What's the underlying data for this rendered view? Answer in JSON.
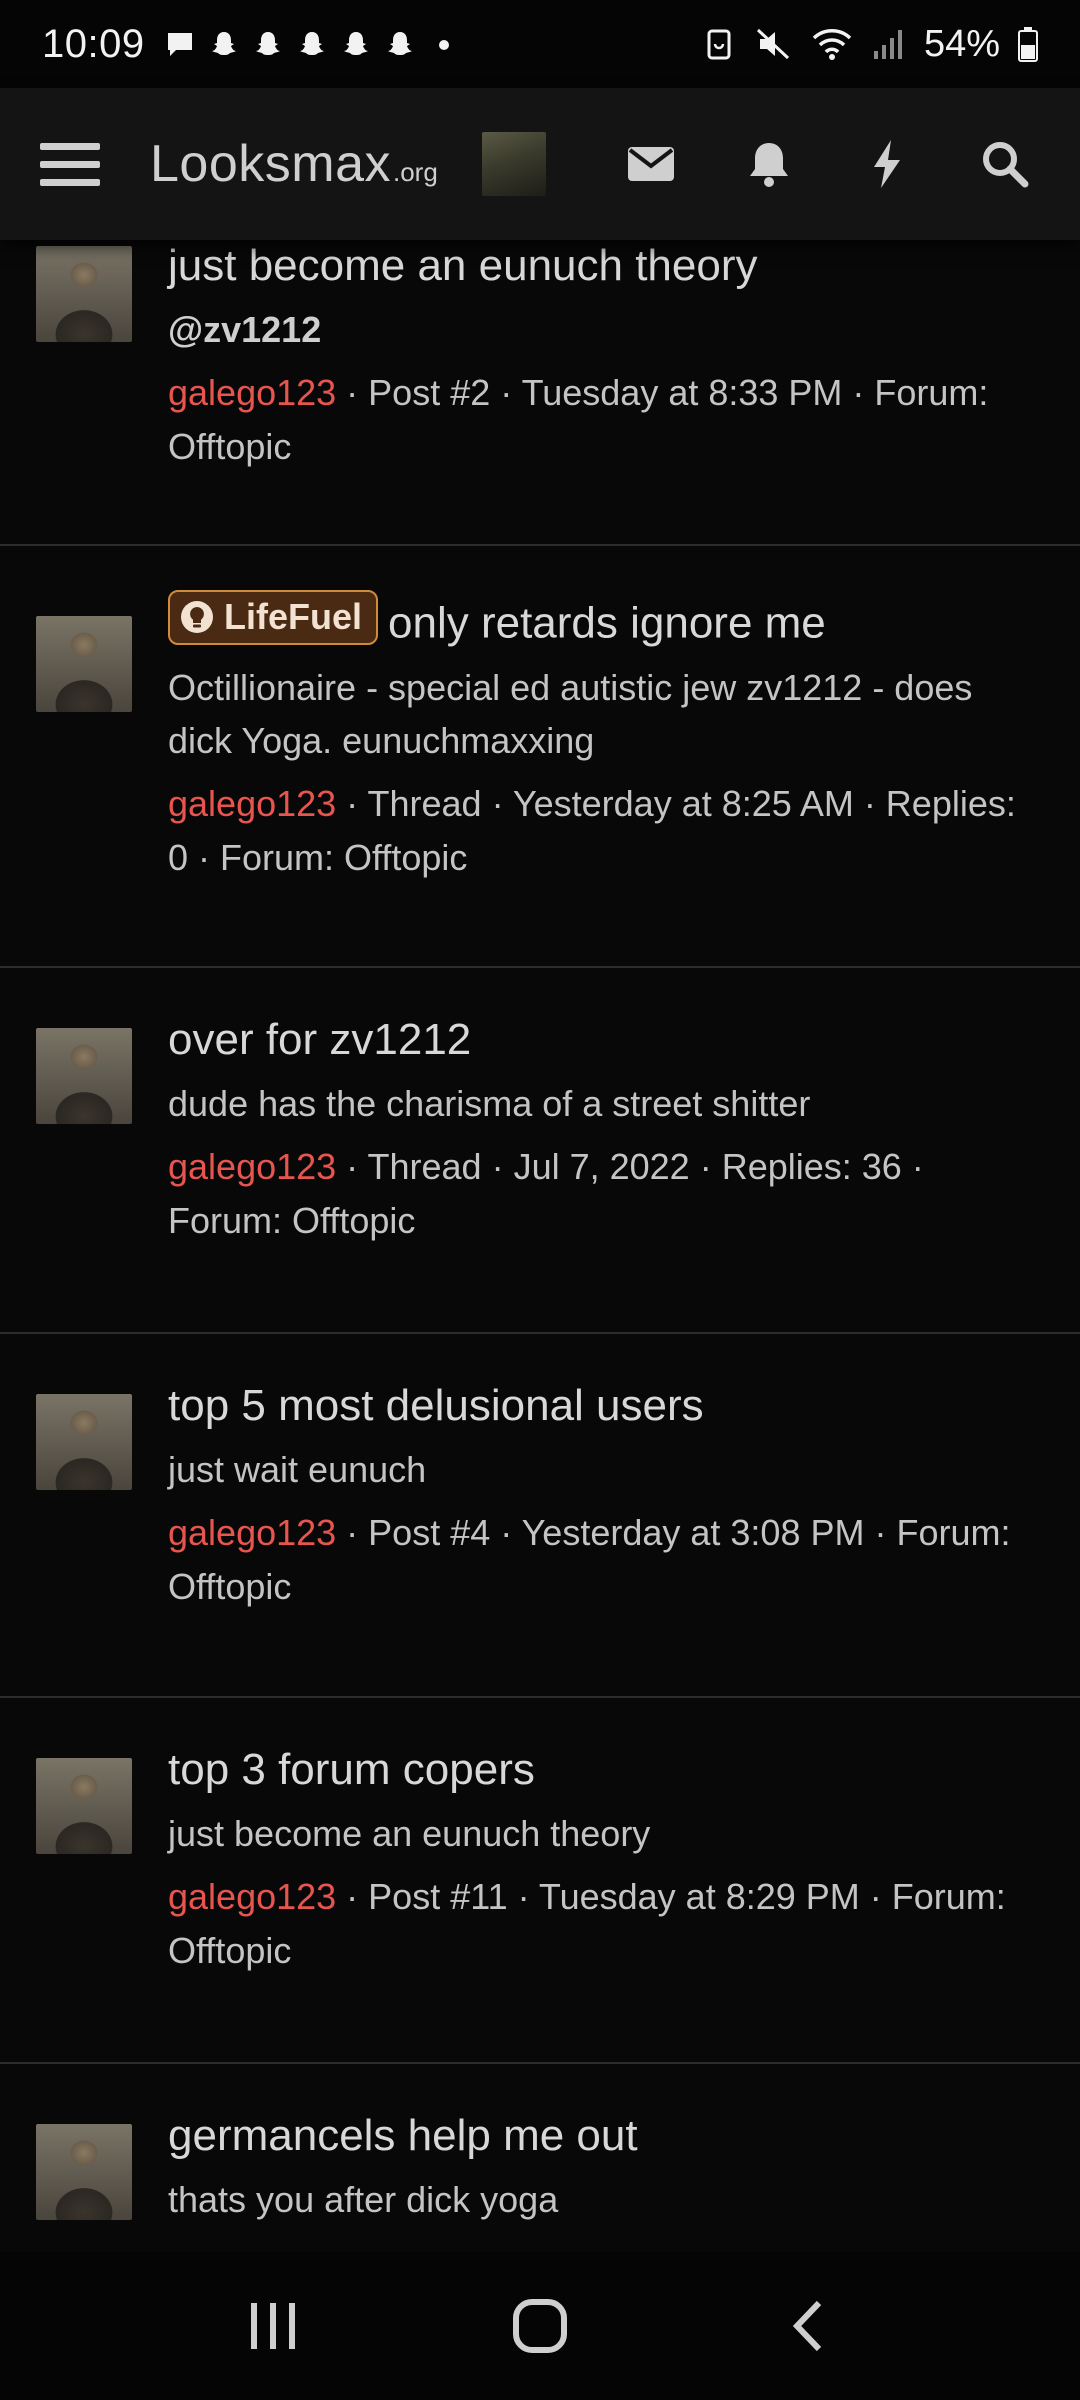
{
  "status_bar": {
    "time": "10:09",
    "battery": "54%",
    "notification_icons": [
      "chat-bubble-icon",
      "snapchat-icon",
      "snapchat-icon",
      "snapchat-icon",
      "snapchat-icon",
      "snapchat-icon",
      "dot-icon"
    ]
  },
  "header": {
    "logo_main": "Looksmax",
    "logo_suffix": ".org",
    "icons": [
      "mail-icon",
      "bell-icon",
      "bolt-icon",
      "search-icon"
    ]
  },
  "colors": {
    "username": "#e8554e",
    "prefix_bg": "#4a2a12",
    "prefix_border": "#d08a3a",
    "background": "#080808"
  },
  "results": [
    {
      "title": "just become an eunuch theory",
      "prefix": "",
      "snippet": "@zv1212",
      "snippet_bold": true,
      "user": "galego123",
      "meta": " · Post #2 · Tuesday at 8:33 PM · Forum: Offtopic"
    },
    {
      "title": "only retards ignore me",
      "prefix": "LifeFuel",
      "snippet": "Octillionaire - special ed autistic jew zv1212 - does dick Yoga. eunuchmaxxing",
      "snippet_bold": false,
      "user": "galego123",
      "meta": " · Thread · Yesterday at 8:25 AM · Replies: 0 · Forum: Offtopic"
    },
    {
      "title": "over for zv1212",
      "prefix": "",
      "snippet": "dude has the charisma of a street shitter",
      "snippet_bold": false,
      "user": "galego123",
      "meta": " · Thread · Jul 7, 2022 · Replies: 36 · Forum: Offtopic"
    },
    {
      "title": "top 5 most delusional users",
      "prefix": "",
      "snippet": "just wait eunuch",
      "snippet_bold": false,
      "user": "galego123",
      "meta": " · Post #4 · Yesterday at 3:08 PM · Forum: Offtopic"
    },
    {
      "title": "top 3 forum copers",
      "prefix": "",
      "snippet": "just become an eunuch theory",
      "snippet_bold": false,
      "user": "galego123",
      "meta": " · Post #11 · Tuesday at 8:29 PM · Forum: Offtopic"
    },
    {
      "title": "germancels help me out",
      "prefix": "",
      "snippet": "thats you after dick yoga",
      "snippet_bold": false,
      "user": "",
      "meta": ""
    }
  ],
  "nav": {
    "buttons": [
      "recent-apps-icon",
      "home-icon",
      "back-icon"
    ]
  }
}
